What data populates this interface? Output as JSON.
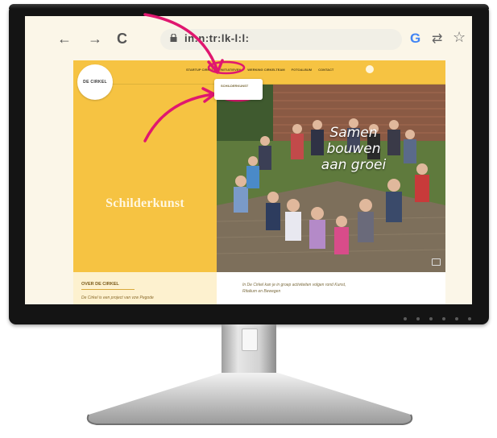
{
  "browser": {
    "back_glyph": "←",
    "forward_glyph": "→",
    "reload_glyph": "C",
    "url": "in:n:tr:lk-l:l:",
    "google_glyph": "G",
    "share_glyph": "⇄",
    "star_glyph": "☆"
  },
  "site": {
    "logo_text": "DE CIRKEL",
    "menu": [
      "STARTUP CIRKEL",
      "INITIATIEVEN",
      "WERKING CIRKELTEAM",
      "FOTOALBUM",
      "CONTACT"
    ],
    "dropdown_item": "SCHILDERKUNST",
    "hero_title": "Schilderkunst",
    "photo_text_lines": [
      "Samen",
      "bouwen",
      "aan groei"
    ],
    "about_title": "OVER DE CIRKEL",
    "about_text": "De Cirkel is een project van vzw Pegode",
    "intro_lines": [
      "In De Cirkel kan je in groep activiteiten volgen rond Kunst,",
      "Ritalium en Bewegen"
    ]
  },
  "annotation_color": "#e0176f",
  "accent_yellow": "#f6c342"
}
